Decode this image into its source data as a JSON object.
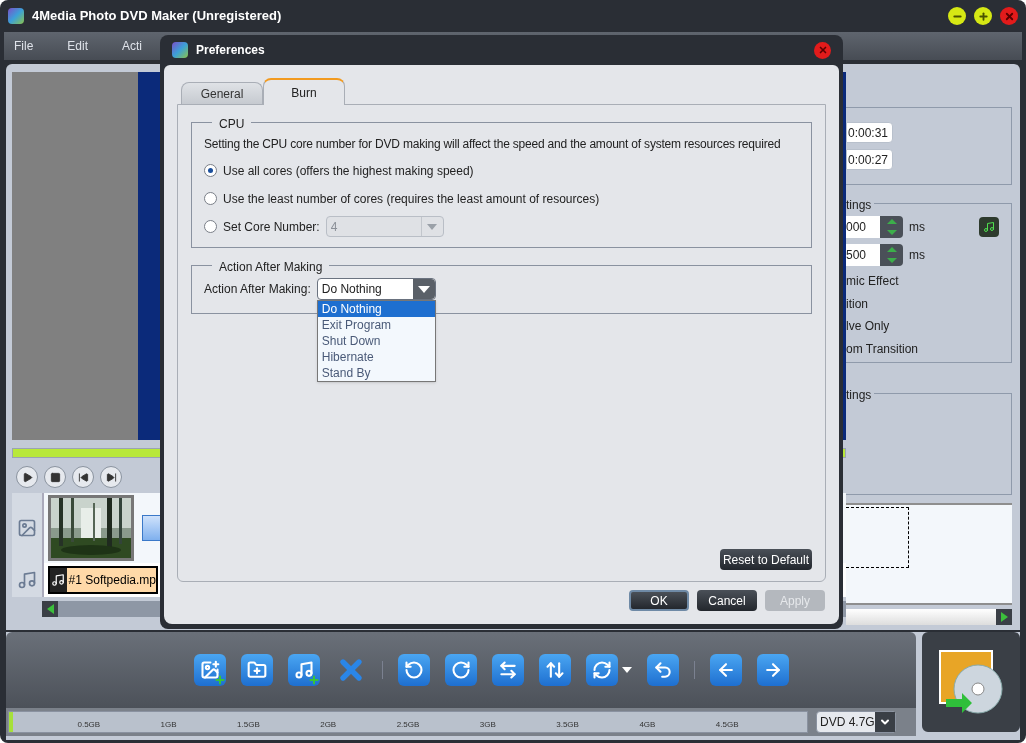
{
  "window": {
    "title": "4Media Photo DVD Maker (Unregistered)"
  },
  "menu": [
    "File",
    "Edit",
    "Acti"
  ],
  "right_panel": {
    "times": [
      "0:00:31",
      "0:00:27"
    ],
    "group_1_legend": "tings",
    "spinners": [
      {
        "value": "000",
        "unit": "ms"
      },
      {
        "value": "500",
        "unit": "ms"
      }
    ],
    "options": [
      "mic Effect",
      "ition",
      "lve Only",
      "om Transition"
    ],
    "group_2_legend": "tings"
  },
  "playback": {
    "level": 1
  },
  "timeline": {
    "audio_clip": "#1 Softpedia.mp"
  },
  "dialog": {
    "title": "Preferences",
    "tabs": [
      {
        "label": "General",
        "selected": false
      },
      {
        "label": "Burn",
        "selected": true
      }
    ],
    "cpu": {
      "legend": "CPU",
      "description": "Setting the CPU core number for DVD making will affect the speed and the amount of system resources required",
      "options": [
        {
          "kind": "radio",
          "label": "Use all cores (offers the highest making speed)",
          "selected": true
        },
        {
          "kind": "radio",
          "label": "Use the least number of cores (requires the least amount of resources)",
          "selected": false
        },
        {
          "kind": "radio-select",
          "label": "Set Core Number:",
          "selected": false
        }
      ],
      "core_number": {
        "value": "4",
        "disabled": true
      }
    },
    "action": {
      "legend": "Action After Making",
      "label": "Action After Making:",
      "value": "Do Nothing",
      "expanded": true,
      "options": [
        {
          "label": "Do Nothing",
          "selected": true
        },
        {
          "label": "Exit Program",
          "selected": false
        },
        {
          "label": "Shut Down",
          "selected": false
        },
        {
          "label": "Hibernate",
          "selected": false
        },
        {
          "label": "Stand By",
          "selected": false
        }
      ]
    },
    "reset_button": "Reset to Default",
    "buttons": [
      {
        "label": "OK",
        "disabled": false
      },
      {
        "label": "Cancel",
        "disabled": false
      },
      {
        "label": "Apply",
        "disabled": true
      }
    ]
  },
  "capacity": {
    "level": 0.004,
    "ticks": [
      "0.5GB",
      "1GB",
      "1.5GB",
      "2GB",
      "2.5GB",
      "3GB",
      "3.5GB",
      "4GB",
      "4.5GB"
    ],
    "disc": "DVD 4.7G"
  }
}
